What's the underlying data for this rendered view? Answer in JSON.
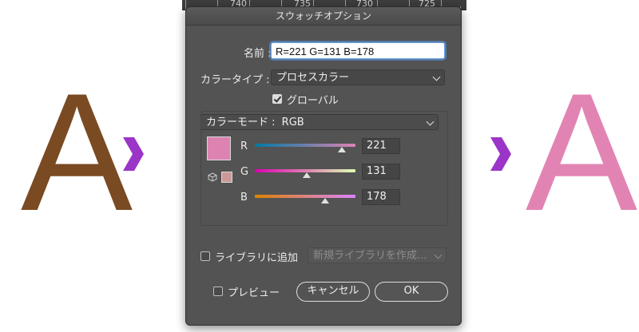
{
  "left_letter": {
    "text": "A",
    "color": "#7a4a22"
  },
  "right_letter": {
    "text": "A",
    "color": "#e284b3"
  },
  "arrow_color": "#9b35c8",
  "ruler": {
    "labels": [
      "740",
      "735",
      "730",
      "725"
    ]
  },
  "dialog": {
    "title": "スウォッチオプション",
    "name_label": "名前 :",
    "name_value": "R=221 G=131 B=178",
    "color_type_label": "カラータイプ :",
    "color_type_value": "プロセスカラー",
    "global_label": "グローバル",
    "global_checked": true,
    "color_mode_label": "カラーモード :",
    "color_mode_value": "RGB",
    "swatch_color": "#dd83b2",
    "channels": [
      {
        "label": "R",
        "value": "221",
        "level": 0.867
      },
      {
        "label": "G",
        "value": "131",
        "level": 0.514
      },
      {
        "label": "B",
        "value": "178",
        "level": 0.698
      }
    ],
    "add_library_label": "ライブラリに追加",
    "library_placeholder": "新規ライブラリを作成...",
    "preview_label": "プレビュー",
    "cancel_label": "キャンセル",
    "ok_label": "OK"
  }
}
